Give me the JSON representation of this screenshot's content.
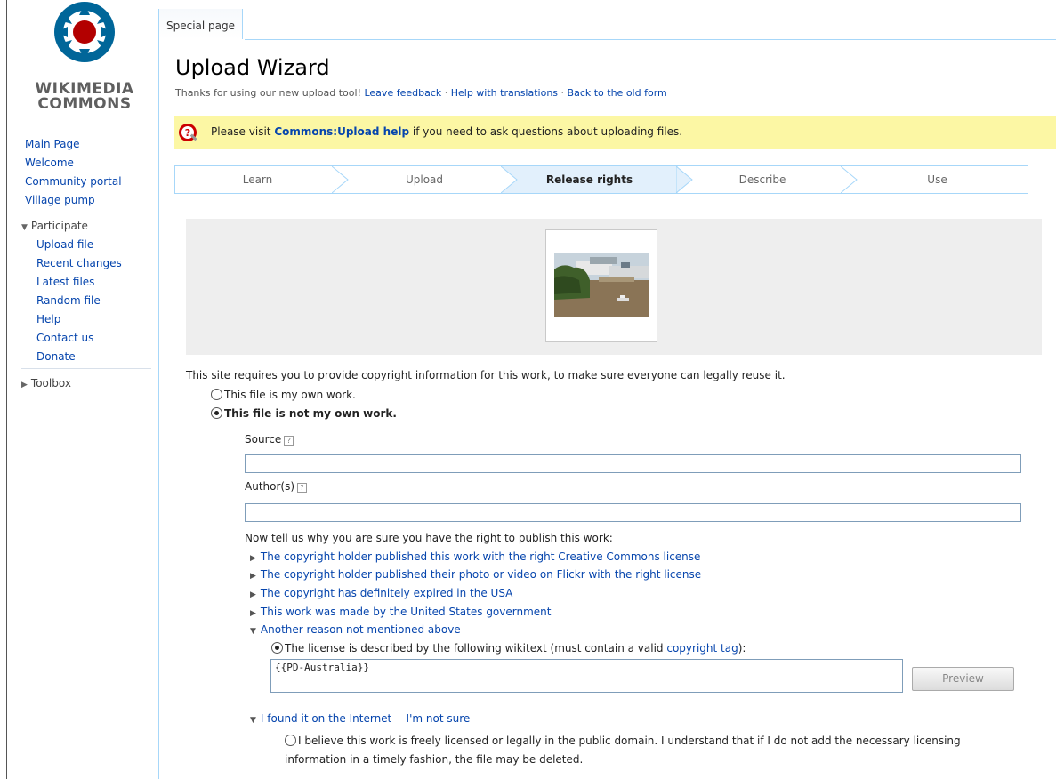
{
  "sidebar": {
    "logo_text_line1": "WIKIMEDIA",
    "logo_text_line2": "COMMONS",
    "main_links": [
      "Main Page",
      "Welcome",
      "Community portal",
      "Village pump"
    ],
    "participate": {
      "heading": "Participate",
      "links": [
        "Upload file",
        "Recent changes",
        "Latest files",
        "Random file",
        "Help",
        "Contact us",
        "Donate"
      ]
    },
    "toolbox": {
      "heading": "Toolbox"
    }
  },
  "tabs": {
    "special_page": "Special page"
  },
  "page": {
    "title": "Upload Wizard",
    "subtitle_text": "Thanks for using our new upload tool!",
    "subtitle_links": [
      "Leave feedback",
      "Help with translations",
      "Back to the old form"
    ],
    "subtitle_sep": "·"
  },
  "notice": {
    "prefix": "Please visit",
    "link": "Commons:Upload help",
    "suffix": "if you need to ask questions about uploading files."
  },
  "steps": [
    {
      "label": "Learn",
      "active": false
    },
    {
      "label": "Upload",
      "active": false
    },
    {
      "label": "Release rights",
      "active": true
    },
    {
      "label": "Describe",
      "active": false
    },
    {
      "label": "Use",
      "active": false
    }
  ],
  "rights": {
    "intro": "This site requires you to provide copyright information for this work, to make sure everyone can legally reuse it.",
    "own_work": "This file is my own work.",
    "not_own_work": "This file is not my own work.",
    "selected": "not_own_work",
    "source_label": "Source",
    "source_value": "",
    "author_label": "Author(s)",
    "author_value": "",
    "help_glyph": "?",
    "why": "Now tell us why you are sure you have the right to publish this work:",
    "reasons": [
      "The copyright holder published this work with the right Creative Commons license",
      "The copyright holder published their photo or video on Flickr with the right license",
      "The copyright has definitely expired in the USA",
      "This work was made by the United States government",
      "Another reason not mentioned above",
      "I found it on the Internet -- I'm not sure"
    ],
    "wikitext_label_prefix": "The license is described by the following wikitext (must contain a valid",
    "wikitext_label_link": "copyright tag",
    "wikitext_label_suffix": "):",
    "wikitext_value": "{{PD-Australia}}",
    "preview_button": "Preview",
    "internet_option": "I believe this work is freely licensed or legally in the public domain. I understand that if I do not add the necessary licensing information in a timely fashion, the file may be deleted."
  },
  "colors": {
    "link": "#0645ad",
    "notice_bg": "#fcf7a4",
    "active_step_bg": "#e2f0fc",
    "border_blue": "#a7d7f9"
  }
}
